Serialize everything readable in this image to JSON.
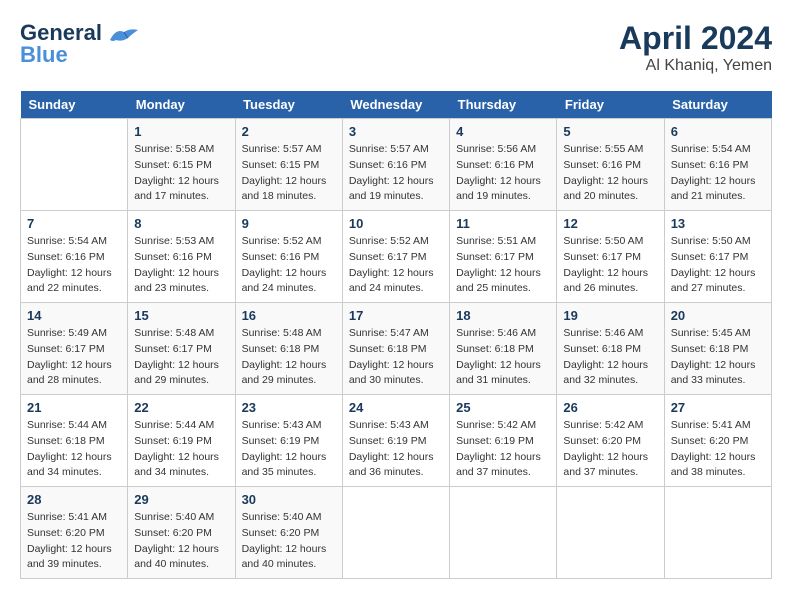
{
  "header": {
    "logo_line1": "General",
    "logo_line2": "Blue",
    "month": "April 2024",
    "location": "Al Khaniq, Yemen"
  },
  "weekdays": [
    "Sunday",
    "Monday",
    "Tuesday",
    "Wednesday",
    "Thursday",
    "Friday",
    "Saturday"
  ],
  "weeks": [
    [
      {
        "day": null
      },
      {
        "day": "1",
        "sunrise": "5:58 AM",
        "sunset": "6:15 PM",
        "daylight": "12 hours and 17 minutes."
      },
      {
        "day": "2",
        "sunrise": "5:57 AM",
        "sunset": "6:15 PM",
        "daylight": "12 hours and 18 minutes."
      },
      {
        "day": "3",
        "sunrise": "5:57 AM",
        "sunset": "6:16 PM",
        "daylight": "12 hours and 19 minutes."
      },
      {
        "day": "4",
        "sunrise": "5:56 AM",
        "sunset": "6:16 PM",
        "daylight": "12 hours and 19 minutes."
      },
      {
        "day": "5",
        "sunrise": "5:55 AM",
        "sunset": "6:16 PM",
        "daylight": "12 hours and 20 minutes."
      },
      {
        "day": "6",
        "sunrise": "5:54 AM",
        "sunset": "6:16 PM",
        "daylight": "12 hours and 21 minutes."
      }
    ],
    [
      {
        "day": "7",
        "sunrise": "5:54 AM",
        "sunset": "6:16 PM",
        "daylight": "12 hours and 22 minutes."
      },
      {
        "day": "8",
        "sunrise": "5:53 AM",
        "sunset": "6:16 PM",
        "daylight": "12 hours and 23 minutes."
      },
      {
        "day": "9",
        "sunrise": "5:52 AM",
        "sunset": "6:16 PM",
        "daylight": "12 hours and 24 minutes."
      },
      {
        "day": "10",
        "sunrise": "5:52 AM",
        "sunset": "6:17 PM",
        "daylight": "12 hours and 24 minutes."
      },
      {
        "day": "11",
        "sunrise": "5:51 AM",
        "sunset": "6:17 PM",
        "daylight": "12 hours and 25 minutes."
      },
      {
        "day": "12",
        "sunrise": "5:50 AM",
        "sunset": "6:17 PM",
        "daylight": "12 hours and 26 minutes."
      },
      {
        "day": "13",
        "sunrise": "5:50 AM",
        "sunset": "6:17 PM",
        "daylight": "12 hours and 27 minutes."
      }
    ],
    [
      {
        "day": "14",
        "sunrise": "5:49 AM",
        "sunset": "6:17 PM",
        "daylight": "12 hours and 28 minutes."
      },
      {
        "day": "15",
        "sunrise": "5:48 AM",
        "sunset": "6:17 PM",
        "daylight": "12 hours and 29 minutes."
      },
      {
        "day": "16",
        "sunrise": "5:48 AM",
        "sunset": "6:18 PM",
        "daylight": "12 hours and 29 minutes."
      },
      {
        "day": "17",
        "sunrise": "5:47 AM",
        "sunset": "6:18 PM",
        "daylight": "12 hours and 30 minutes."
      },
      {
        "day": "18",
        "sunrise": "5:46 AM",
        "sunset": "6:18 PM",
        "daylight": "12 hours and 31 minutes."
      },
      {
        "day": "19",
        "sunrise": "5:46 AM",
        "sunset": "6:18 PM",
        "daylight": "12 hours and 32 minutes."
      },
      {
        "day": "20",
        "sunrise": "5:45 AM",
        "sunset": "6:18 PM",
        "daylight": "12 hours and 33 minutes."
      }
    ],
    [
      {
        "day": "21",
        "sunrise": "5:44 AM",
        "sunset": "6:18 PM",
        "daylight": "12 hours and 34 minutes."
      },
      {
        "day": "22",
        "sunrise": "5:44 AM",
        "sunset": "6:19 PM",
        "daylight": "12 hours and 34 minutes."
      },
      {
        "day": "23",
        "sunrise": "5:43 AM",
        "sunset": "6:19 PM",
        "daylight": "12 hours and 35 minutes."
      },
      {
        "day": "24",
        "sunrise": "5:43 AM",
        "sunset": "6:19 PM",
        "daylight": "12 hours and 36 minutes."
      },
      {
        "day": "25",
        "sunrise": "5:42 AM",
        "sunset": "6:19 PM",
        "daylight": "12 hours and 37 minutes."
      },
      {
        "day": "26",
        "sunrise": "5:42 AM",
        "sunset": "6:20 PM",
        "daylight": "12 hours and 37 minutes."
      },
      {
        "day": "27",
        "sunrise": "5:41 AM",
        "sunset": "6:20 PM",
        "daylight": "12 hours and 38 minutes."
      }
    ],
    [
      {
        "day": "28",
        "sunrise": "5:41 AM",
        "sunset": "6:20 PM",
        "daylight": "12 hours and 39 minutes."
      },
      {
        "day": "29",
        "sunrise": "5:40 AM",
        "sunset": "6:20 PM",
        "daylight": "12 hours and 40 minutes."
      },
      {
        "day": "30",
        "sunrise": "5:40 AM",
        "sunset": "6:20 PM",
        "daylight": "12 hours and 40 minutes."
      },
      {
        "day": null
      },
      {
        "day": null
      },
      {
        "day": null
      },
      {
        "day": null
      }
    ]
  ],
  "labels": {
    "sunrise": "Sunrise:",
    "sunset": "Sunset:",
    "daylight": "Daylight:"
  }
}
